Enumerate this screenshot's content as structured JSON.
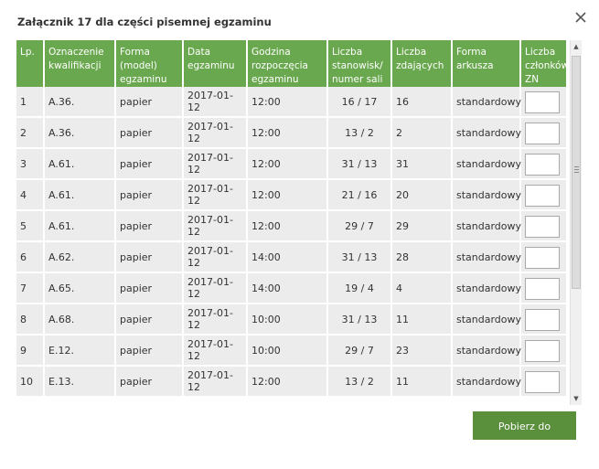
{
  "dialog": {
    "title": "Załącznik 17 dla części pisemnej egzaminu",
    "download_label": "Pobierz do wydruku"
  },
  "table": {
    "headers": [
      "Lp.",
      "Oznaczenie kwalifikacji",
      "Forma (model) egzaminu",
      "Data egzaminu",
      "Godzina rozpoczęcia egzaminu",
      "Liczba stanowisk/ numer sali",
      "Liczba zdających",
      "Forma arkusza",
      "Liczba członków ZN"
    ],
    "rows": [
      {
        "lp": "1",
        "kwal": "A.36.",
        "forma": "papier",
        "data": "2017-01-12",
        "godzina": "12:00",
        "stan": "16 / 17",
        "zdaj": "16",
        "arkusz": "standardowy",
        "zn": ""
      },
      {
        "lp": "2",
        "kwal": "A.36.",
        "forma": "papier",
        "data": "2017-01-12",
        "godzina": "12:00",
        "stan": "13 / 2",
        "zdaj": "2",
        "arkusz": "standardowy",
        "zn": ""
      },
      {
        "lp": "3",
        "kwal": "A.61.",
        "forma": "papier",
        "data": "2017-01-12",
        "godzina": "12:00",
        "stan": "31 / 13",
        "zdaj": "31",
        "arkusz": "standardowy",
        "zn": ""
      },
      {
        "lp": "4",
        "kwal": "A.61.",
        "forma": "papier",
        "data": "2017-01-12",
        "godzina": "12:00",
        "stan": "21 / 16",
        "zdaj": "20",
        "arkusz": "standardowy",
        "zn": ""
      },
      {
        "lp": "5",
        "kwal": "A.61.",
        "forma": "papier",
        "data": "2017-01-12",
        "godzina": "12:00",
        "stan": "29 / 7",
        "zdaj": "29",
        "arkusz": "standardowy",
        "zn": ""
      },
      {
        "lp": "6",
        "kwal": "A.62.",
        "forma": "papier",
        "data": "2017-01-12",
        "godzina": "14:00",
        "stan": "31 / 13",
        "zdaj": "28",
        "arkusz": "standardowy",
        "zn": ""
      },
      {
        "lp": "7",
        "kwal": "A.65.",
        "forma": "papier",
        "data": "2017-01-12",
        "godzina": "14:00",
        "stan": "19 / 4",
        "zdaj": "4",
        "arkusz": "standardowy",
        "zn": ""
      },
      {
        "lp": "8",
        "kwal": "A.68.",
        "forma": "papier",
        "data": "2017-01-12",
        "godzina": "10:00",
        "stan": "31 / 13",
        "zdaj": "11",
        "arkusz": "standardowy",
        "zn": ""
      },
      {
        "lp": "9",
        "kwal": "E.12.",
        "forma": "papier",
        "data": "2017-01-12",
        "godzina": "10:00",
        "stan": "29 / 7",
        "zdaj": "23",
        "arkusz": "standardowy",
        "zn": ""
      },
      {
        "lp": "10",
        "kwal": "E.13.",
        "forma": "papier",
        "data": "2017-01-12",
        "godzina": "12:00",
        "stan": "13 / 2",
        "zdaj": "11",
        "arkusz": "standardowy",
        "zn": ""
      }
    ]
  },
  "icons": {
    "close": "close-icon",
    "scroll_up": "scroll-up-arrow-icon",
    "scroll_down": "scroll-down-arrow-icon"
  },
  "colors": {
    "header_bg": "#6aa84f",
    "button_bg": "#5a8f3c",
    "row_bg": "#ececec"
  }
}
